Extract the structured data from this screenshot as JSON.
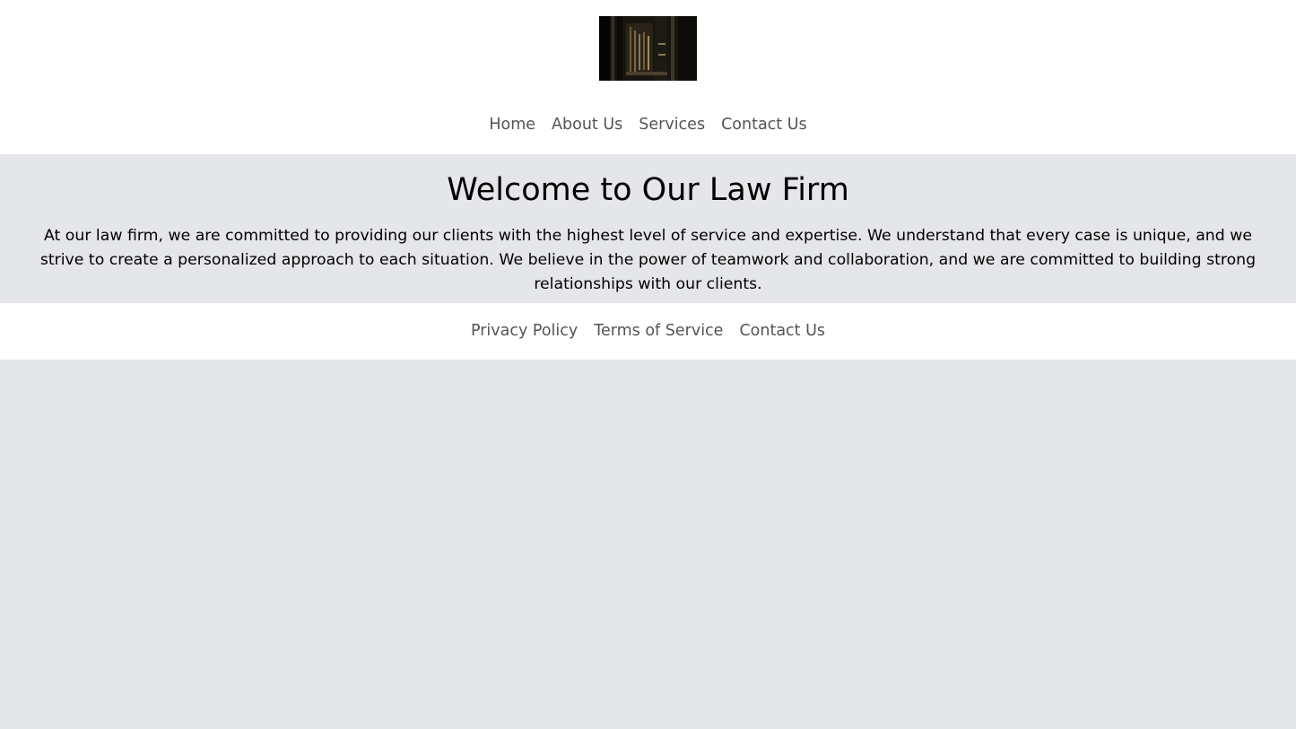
{
  "header": {
    "logo_icon": "law-firm-logo-image",
    "nav": [
      {
        "label": "Home"
      },
      {
        "label": "About Us"
      },
      {
        "label": "Services"
      },
      {
        "label": "Contact Us"
      }
    ]
  },
  "hero": {
    "title": "Welcome to Our Law Firm",
    "body": "At our law firm, we are committed to providing our clients with the highest level of service and expertise. We understand that every case is unique, and we strive to create a personalized approach to each situation. We believe in the power of teamwork and collaboration, and we are committed to building strong relationships with our clients."
  },
  "footer": {
    "links": [
      {
        "label": "Privacy Policy"
      },
      {
        "label": "Terms of Service"
      },
      {
        "label": "Contact Us"
      }
    ]
  },
  "colors": {
    "page_background": "#e5e6e9",
    "header_background": "#ffffff",
    "link_text": "#545454",
    "body_text": "#000000"
  }
}
